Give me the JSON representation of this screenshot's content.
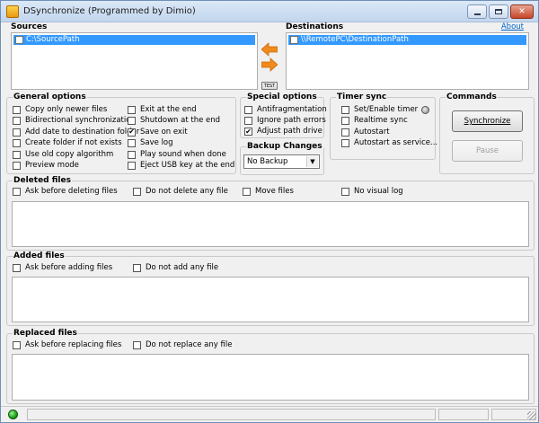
{
  "window": {
    "title": "DSynchronize (Programmed by Dimio)",
    "about": "About"
  },
  "sources": {
    "label": "Sources",
    "items": [
      "C:\\SourcePath"
    ]
  },
  "destinations": {
    "label": "Destinations",
    "items": [
      "\\\\RemotePC\\DestinationPath"
    ]
  },
  "test_button": "TEST",
  "general_options": {
    "label": "General options",
    "col1": [
      {
        "label": "Copy only newer files",
        "checked": false
      },
      {
        "label": "Bidirectional synchronization",
        "checked": false
      },
      {
        "label": "Add date to destination folder",
        "checked": false
      },
      {
        "label": "Create folder if not exists",
        "checked": false
      },
      {
        "label": "Use old copy algorithm",
        "checked": false
      },
      {
        "label": "Preview mode",
        "checked": false
      }
    ],
    "col2": [
      {
        "label": "Exit at the end",
        "checked": false
      },
      {
        "label": "Shutdown at the end",
        "checked": false
      },
      {
        "label": "Save on exit",
        "checked": true
      },
      {
        "label": "Save log",
        "checked": false
      },
      {
        "label": "Play sound when done",
        "checked": false
      },
      {
        "label": "Eject USB key at the end",
        "checked": false
      }
    ]
  },
  "special_options": {
    "label": "Special options",
    "items": [
      {
        "label": "Antifragmentation",
        "checked": false
      },
      {
        "label": "Ignore path errors",
        "checked": false
      },
      {
        "label": "Adjust path drive",
        "checked": true
      }
    ]
  },
  "backup_changes": {
    "label": "Backup Changes",
    "value": "No Backup"
  },
  "timer_sync": {
    "label": "Timer sync",
    "items": [
      {
        "label": "Set/Enable timer",
        "checked": false
      },
      {
        "label": "Realtime sync",
        "checked": false
      },
      {
        "label": "Autostart",
        "checked": false
      },
      {
        "label": "Autostart as service...",
        "checked": false
      }
    ]
  },
  "commands": {
    "label": "Commands",
    "synchronize": "Synchronize",
    "pause": "Pause"
  },
  "deleted_files": {
    "label": "Deleted files",
    "options": [
      {
        "label": "Ask before deleting files",
        "checked": false
      },
      {
        "label": "Do not delete any file",
        "checked": false
      },
      {
        "label": "Move files",
        "checked": false
      },
      {
        "label": "No visual log",
        "checked": false
      }
    ]
  },
  "added_files": {
    "label": "Added files",
    "options": [
      {
        "label": "Ask before adding files",
        "checked": false
      },
      {
        "label": "Do not add any file",
        "checked": false
      }
    ]
  },
  "replaced_files": {
    "label": "Replaced files",
    "options": [
      {
        "label": "Ask before replacing files",
        "checked": false
      },
      {
        "label": "Do not replace any file",
        "checked": false
      }
    ]
  },
  "colors": {
    "selection": "#3399ff",
    "arrow": "#f08a1c",
    "link": "#0066cc"
  }
}
